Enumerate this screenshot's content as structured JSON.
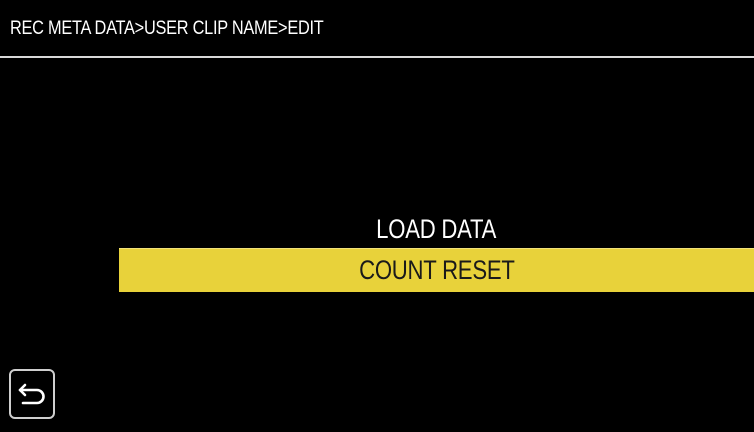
{
  "header": {
    "breadcrumb": "REC META DATA>USER CLIP NAME>EDIT"
  },
  "menu": {
    "items": [
      {
        "label": "LOAD DATA",
        "selected": false
      },
      {
        "label": "COUNT RESET",
        "selected": true
      }
    ],
    "highlight_color": "#E8D23A"
  },
  "footer": {
    "back_icon": "return-arrow-icon"
  }
}
